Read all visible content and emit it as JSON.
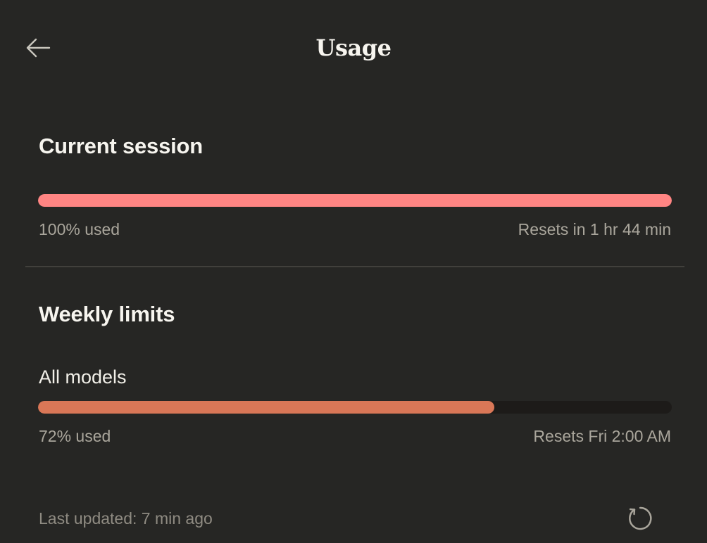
{
  "header": {
    "title": "Usage",
    "back_icon": "arrow-left-icon"
  },
  "current_session": {
    "heading": "Current session",
    "percent_used": 100,
    "used_label": "100% used",
    "reset_label": "Resets in 1 hr 44 min",
    "bar_color": "#ff8583"
  },
  "weekly_limits": {
    "heading": "Weekly limits",
    "models": [
      {
        "name": "All models",
        "percent_used": 72,
        "used_label": "72% used",
        "reset_label": "Resets Fri 2:00 AM",
        "bar_color": "#d97757"
      }
    ]
  },
  "footer": {
    "last_updated": "Last updated: 7 min ago",
    "refresh_icon": "refresh-icon"
  },
  "colors": {
    "background": "#262624",
    "track": "#1d1b19",
    "divider": "#41403c"
  }
}
